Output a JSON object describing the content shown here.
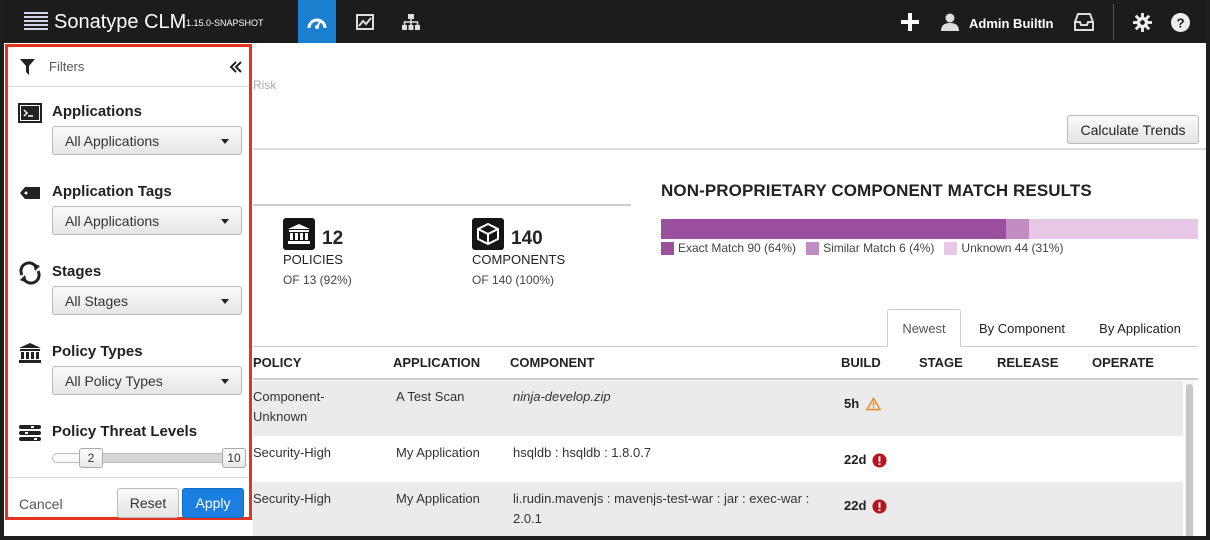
{
  "header": {
    "brand": "Sonatype CLM",
    "version": "1.15.0-SNAPSHOT",
    "nav": [
      "dashboard-icon",
      "chart-icon",
      "hierarchy-icon"
    ],
    "user": "Admin BuiltIn",
    "icons": [
      "plus-icon",
      "user-icon",
      "inbox-icon",
      "gear-icon",
      "help-icon"
    ]
  },
  "main": {
    "breadcrumb": "Risk",
    "calculate_trends": "Calculate Trends",
    "stats": [
      {
        "icon": "bank-icon",
        "value": "12",
        "label": "POLICIES",
        "sub": "OF 13 (92%)"
      },
      {
        "icon": "cube-icon",
        "value": "140",
        "label": "COMPONENTS",
        "sub": "OF 140 (100%)"
      }
    ],
    "match": {
      "title": "NON-PROPRIETARY COMPONENT MATCH RESULTS",
      "segments": [
        {
          "label": "Exact Match 90 (64%)",
          "value": 90,
          "color": "#9b4f9f"
        },
        {
          "label": "Similar Match 6 (4%)",
          "value": 6,
          "color": "#c08cc2"
        },
        {
          "label": "Unknown 44 (31%)",
          "value": 44,
          "color": "#e6c8e6"
        }
      ]
    },
    "tabs": [
      "Newest",
      "By Component",
      "By Application"
    ],
    "table": {
      "headers": [
        "POLICY",
        "APPLICATION",
        "COMPONENT",
        "BUILD",
        "STAGE",
        "RELEASE",
        "OPERATE"
      ],
      "rows": [
        {
          "policy": "Component-\nUnknown",
          "application": "A Test Scan",
          "component": "ninja-develop.zip",
          "build": "5h",
          "level": "warning"
        },
        {
          "policy": "Security-High",
          "application": "My Application",
          "component": "hsqldb : hsqldb : 1.8.0.7",
          "build": "22d",
          "level": "error"
        },
        {
          "policy": "Security-High",
          "application": "My Application",
          "component": "li.rudin.mavenjs : mavenjs-test-war : jar : exec-war :\n2.0.1",
          "build": "22d",
          "level": "error"
        }
      ]
    }
  },
  "filters": {
    "title": "Filters",
    "sections": [
      {
        "title": "Applications",
        "value": "All Applications",
        "icon": "terminal-icon"
      },
      {
        "title": "Application Tags",
        "value": "All Applications",
        "icon": "tag-icon"
      },
      {
        "title": "Stages",
        "value": "All Stages",
        "icon": "cycle-icon"
      },
      {
        "title": "Policy Types",
        "value": "All Policy Types",
        "icon": "bank-icon"
      }
    ],
    "threat": {
      "title": "Policy Threat Levels",
      "min": "2",
      "max": "10"
    },
    "cancel": "Cancel",
    "reset": "Reset",
    "apply": "Apply"
  }
}
